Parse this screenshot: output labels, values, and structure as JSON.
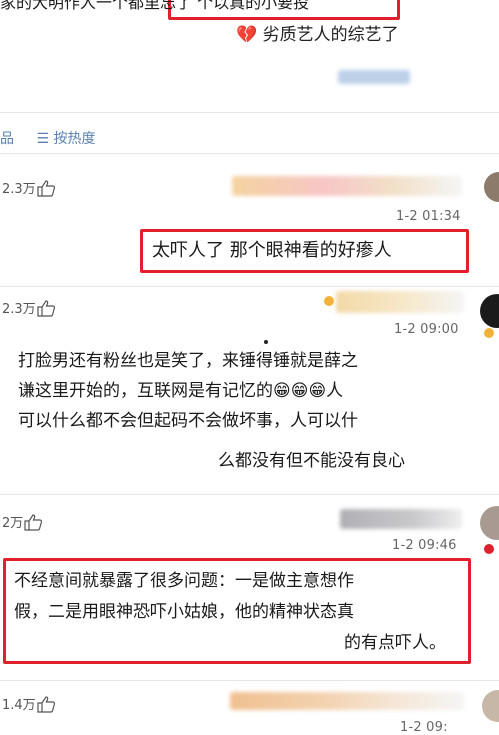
{
  "top": {
    "line_1": "家的大明作人一个都里忘了  个以真的小要投",
    "line_2": "劣质艺人的综艺了",
    "broken_heart": "💔"
  },
  "sort_bar": {
    "sort_icon_glyph": "☰",
    "label": "按热度",
    "prefix": "品"
  },
  "comments": [
    {
      "likes": "2.3万",
      "time": "1-2 01:34",
      "text_lines": [
        "太吓人了 那个眼神看的好瘆人"
      ]
    },
    {
      "likes": "2.3万",
      "time": "1-2 09:00",
      "text_lines": [
        "打脸男还有粉丝也是笑了，来锤得锤就是薛之",
        "谦这里开始的，互联网是有记忆的😁😁😁人",
        "可以什么都不会但起码不会做坏事，人可以什",
        "么都没有但不能没有良心"
      ]
    },
    {
      "likes": "2万",
      "time": "1-2 09:46",
      "text_lines": [
        "不经意间就暴露了很多问题：一是做主意想作",
        "假，二是用眼神恐吓小姑娘，他的精神状态真",
        "的有点吓人。"
      ]
    },
    {
      "likes": "1.4万",
      "time": "1-2 09:"
    }
  ],
  "colors": {
    "highlight_border": "#e0202a",
    "link_blue": "#5a7fb0",
    "timestamp_gray": "#666666"
  }
}
